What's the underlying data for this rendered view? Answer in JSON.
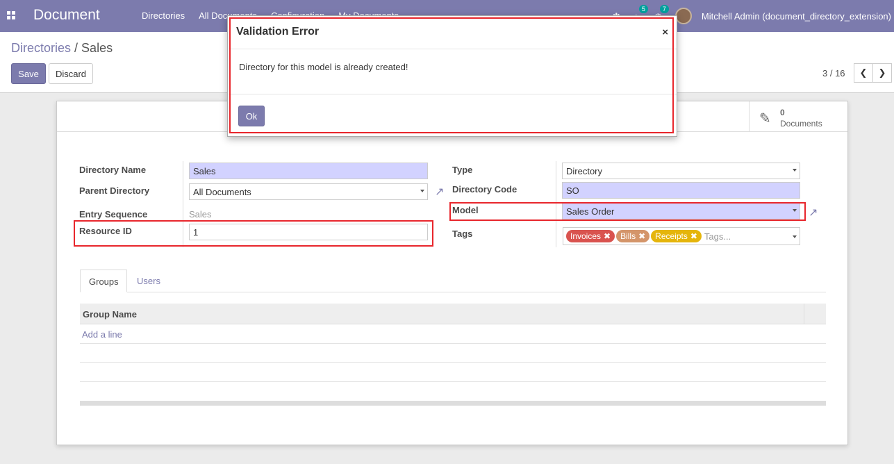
{
  "navbar": {
    "brand": "Document",
    "menu": [
      "Directories",
      "All Documents",
      "Configuration",
      "My Documents"
    ],
    "messages_count": "5",
    "activities_count": "7",
    "user": "Mitchell Admin (document_directory_extension)"
  },
  "breadcrumb": {
    "parent": "Directories",
    "separator": " / ",
    "current": "Sales"
  },
  "buttons": {
    "save": "Save",
    "discard": "Discard"
  },
  "pager": {
    "value": "3 / 16"
  },
  "stat_button": {
    "value": "0",
    "label": "Documents"
  },
  "form": {
    "directory_name_label": "Directory Name",
    "directory_name": "Sales",
    "parent_directory_label": "Parent Directory",
    "parent_directory": "All Documents",
    "entry_sequence_label": "Entry Sequence",
    "entry_sequence": "Sales",
    "resource_id_label": "Resource ID",
    "resource_id": "1",
    "type_label": "Type",
    "type": "Directory",
    "directory_code_label": "Directory Code",
    "directory_code": "SO",
    "model_label": "Model",
    "model": "Sales Order",
    "tags_label": "Tags",
    "tags": [
      {
        "label": "Invoices",
        "color": "#d9534f"
      },
      {
        "label": "Bills",
        "color": "#d4956a"
      },
      {
        "label": "Receipts",
        "color": "#e5b50b"
      }
    ],
    "tags_placeholder": "Tags..."
  },
  "notebook": {
    "tabs": [
      "Groups",
      "Users"
    ],
    "column": "Group Name",
    "add_line": "Add a line"
  },
  "modal": {
    "title": "Validation Error",
    "close": "×",
    "message": "Directory for this model is already created!",
    "ok": "Ok"
  },
  "colors": {
    "brand": "#7c7bad",
    "highlight": "#e8262c",
    "required_bg": "#d2d2ff"
  }
}
